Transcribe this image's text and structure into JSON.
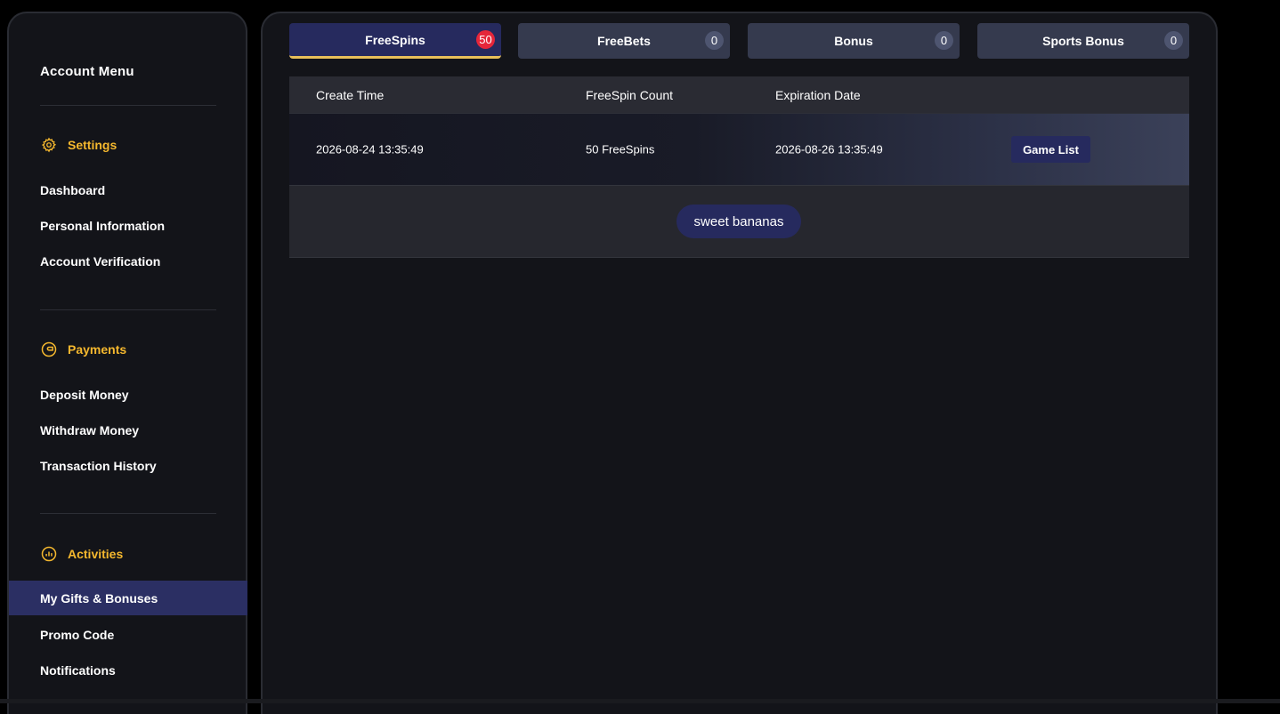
{
  "sidebar": {
    "title": "Account Menu",
    "sections": {
      "settings": {
        "label": "Settings",
        "icon": "gear-icon"
      },
      "payments": {
        "label": "Payments",
        "icon": "wallet-icon"
      },
      "activities": {
        "label": "Activities",
        "icon": "chart-circle-icon"
      }
    },
    "items": {
      "dashboard": "Dashboard",
      "personal_information": "Personal Information",
      "account_verification": "Account Verification",
      "deposit_money": "Deposit Money",
      "withdraw_money": "Withdraw Money",
      "transaction_history": "Transaction History",
      "my_gifts_bonuses": "My Gifts & Bonuses",
      "promo_code": "Promo Code",
      "notifications": "Notifications"
    },
    "active_item": "My Gifts & Bonuses"
  },
  "tabs": [
    {
      "label": "FreeSpins",
      "count": "50",
      "active": true
    },
    {
      "label": "FreeBets",
      "count": "0",
      "active": false
    },
    {
      "label": "Bonus",
      "count": "0",
      "active": false
    },
    {
      "label": "Sports Bonus",
      "count": "0",
      "active": false
    }
  ],
  "table": {
    "headers": {
      "create_time": "Create Time",
      "freespin_count": "FreeSpin Count",
      "expiration_date": "Expiration Date"
    },
    "rows": [
      {
        "create_time": "2026-08-24 13:35:49",
        "freespin_count": "50 FreeSpins",
        "expiration_date": "2026-08-26 13:35:49",
        "action_label": "Game List"
      }
    ],
    "games": [
      "sweet bananas"
    ]
  },
  "colors": {
    "accent_gold": "#f5b82e",
    "active_navy": "#262a5e",
    "badge_red": "#e5263a",
    "panel_bg": "#131419"
  }
}
